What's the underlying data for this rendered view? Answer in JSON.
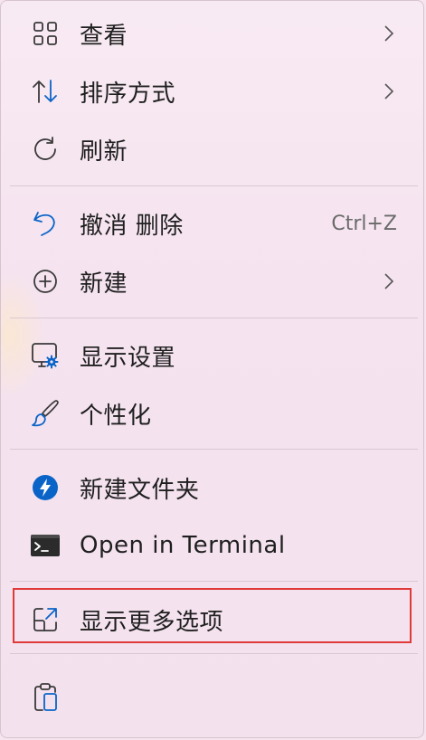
{
  "menu": {
    "items": [
      {
        "label": "查看",
        "icon": "grid-icon",
        "submenu": true
      },
      {
        "label": "排序方式",
        "icon": "sort-icon",
        "submenu": true
      },
      {
        "label": "刷新",
        "icon": "refresh-icon"
      },
      {
        "label": "撤消 删除",
        "icon": "undo-icon",
        "shortcut": "Ctrl+Z"
      },
      {
        "label": "新建",
        "icon": "new-icon",
        "submenu": true
      },
      {
        "label": "显示设置",
        "icon": "display-settings-icon"
      },
      {
        "label": "个性化",
        "icon": "brush-icon"
      },
      {
        "label": "新建文件夹",
        "icon": "power-automate-icon"
      },
      {
        "label": "Open in Terminal",
        "icon": "terminal-icon"
      },
      {
        "label": "显示更多选项",
        "icon": "show-more-options-icon",
        "highlighted": true
      }
    ],
    "bottom_icon": "clipboard-icon"
  },
  "colors": {
    "accent": "#0a64c8",
    "highlight_border": "#e03a3a",
    "background": "#f6e4ee"
  }
}
